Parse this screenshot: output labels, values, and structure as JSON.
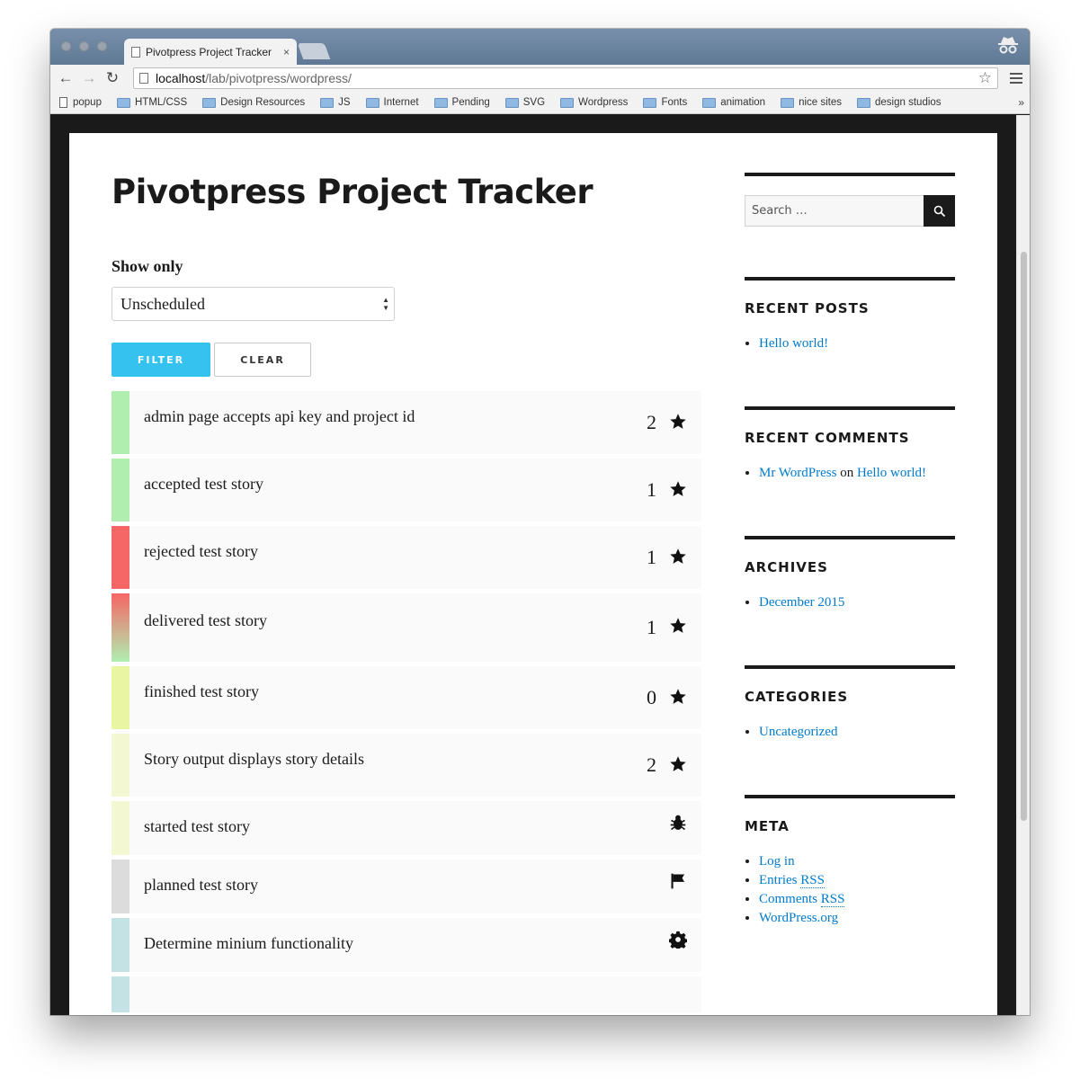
{
  "browser": {
    "tab_title": "Pivotpress Project Tracker",
    "tab_close": "×",
    "url_host": "localhost",
    "url_path": "/lab/pivotpress/wordpress/",
    "bookmarks": [
      "popup",
      "HTML/CSS",
      "Design Resources",
      "JS",
      "Internet",
      "Pending",
      "SVG",
      "Wordpress",
      "Fonts",
      "animation",
      "nice sites",
      "design studios"
    ],
    "more": "»"
  },
  "page": {
    "title": "Pivotpress Project Tracker",
    "filter_label": "Show only",
    "filter_value": "Unscheduled",
    "filter_button": "FILTER",
    "clear_button": "CLEAR"
  },
  "stories": [
    {
      "name": "admin page accepts api key and project id",
      "points": "2",
      "icon": "star-icon",
      "color": "#b0eeb0"
    },
    {
      "name": "accepted test story",
      "points": "1",
      "icon": "star-icon",
      "color": "#b0eeb0"
    },
    {
      "name": "rejected test story",
      "points": "1",
      "icon": "star-icon",
      "color": "#f56666"
    },
    {
      "name": "delivered test story",
      "points": "1",
      "icon": "star-icon",
      "color": "gradient"
    },
    {
      "name": "finished test story",
      "points": "0",
      "icon": "star-icon",
      "color": "#e9f5a3"
    },
    {
      "name": "Story output displays story details",
      "points": "2",
      "icon": "star-icon",
      "color": "#f3f8d2"
    },
    {
      "name": "started test story",
      "points": "",
      "icon": "bug-icon",
      "color": "#f3f8d2"
    },
    {
      "name": "planned test story",
      "points": "",
      "icon": "flag-icon",
      "color": "#dcdcdc"
    },
    {
      "name": "Determine minium functionality",
      "points": "",
      "icon": "gear-icon",
      "color": "#c4e2e4"
    }
  ],
  "sidebar": {
    "search_placeholder": "Search …",
    "recent_posts": {
      "title": "RECENT POSTS",
      "items": [
        "Hello world!"
      ]
    },
    "recent_comments": {
      "title": "RECENT COMMENTS",
      "author": "Mr WordPress",
      "on": "on",
      "post": "Hello world!"
    },
    "archives": {
      "title": "ARCHIVES",
      "items": [
        "December 2015"
      ]
    },
    "categories": {
      "title": "CATEGORIES",
      "items": [
        "Uncategorized"
      ]
    },
    "meta": {
      "title": "META",
      "login": "Log in",
      "entries": "Entries",
      "comments": "Comments",
      "rss": "RSS",
      "wordpress": "WordPress.org"
    }
  }
}
